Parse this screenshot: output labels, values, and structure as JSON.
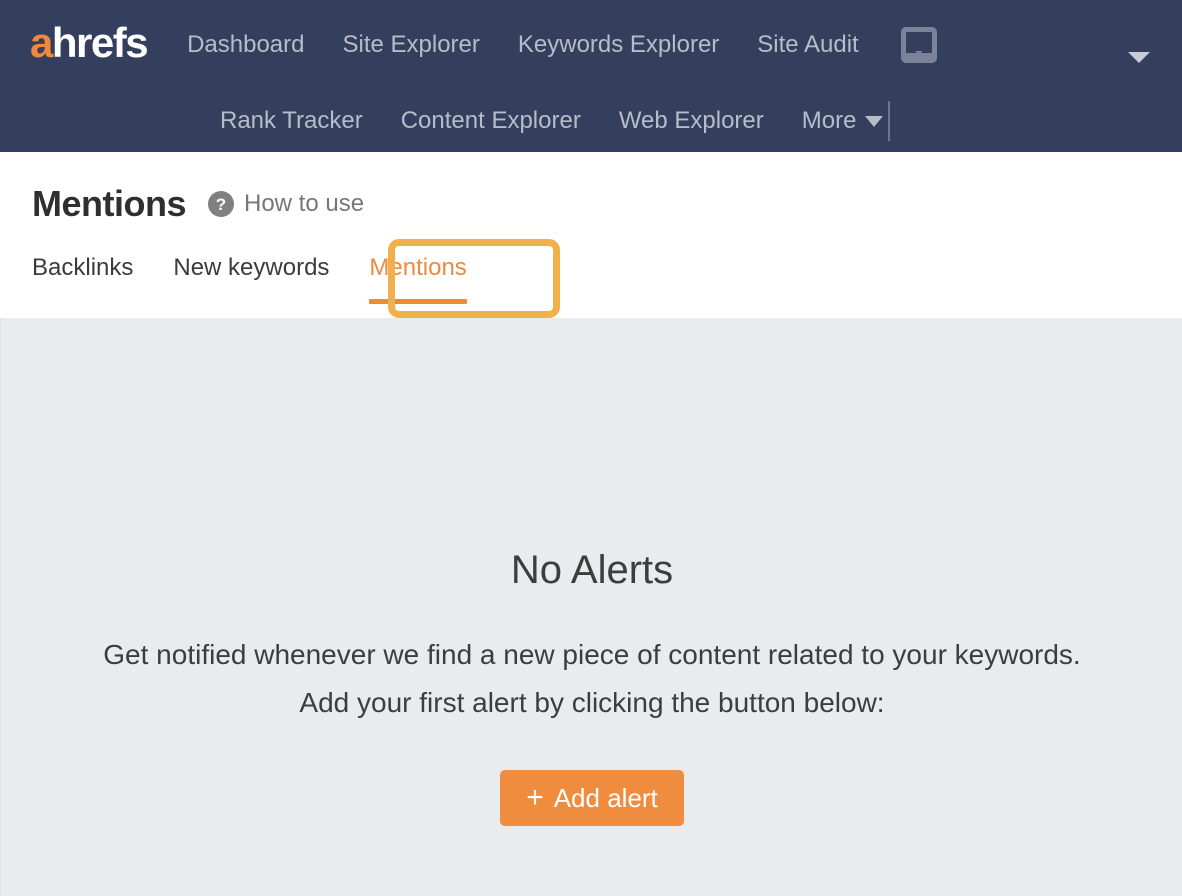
{
  "brand": {
    "logo_a": "a",
    "logo_rest": "hrefs",
    "accent_orange": "#f0893e",
    "nav_background": "#333f5c",
    "content_background": "#eaebed",
    "highlight_amber": "#f0b04c"
  },
  "topnav": {
    "row1": [
      {
        "label": "Dashboard",
        "name": "nav-dashboard"
      },
      {
        "label": "Site Explorer",
        "name": "nav-site-explorer"
      },
      {
        "label": "Keywords Explorer",
        "name": "nav-keywords-explorer"
      },
      {
        "label": "Site Audit",
        "name": "nav-site-audit"
      }
    ],
    "row2": [
      {
        "label": "Rank Tracker",
        "name": "nav-rank-tracker"
      },
      {
        "label": "Content Explorer",
        "name": "nav-content-explorer"
      },
      {
        "label": "Web Explorer",
        "name": "nav-web-explorer"
      }
    ],
    "more_label": "More",
    "inbox_icon": "inbox-icon",
    "account_caret_icon": "chevron-down-icon",
    "more_caret_icon": "chevron-down-icon"
  },
  "header": {
    "title": "Mentions",
    "help_icon": "question-mark-icon",
    "help_glyph": "?",
    "help_label": "How to use"
  },
  "tabs": [
    {
      "label": "Backlinks",
      "name": "tab-backlinks",
      "active": false
    },
    {
      "label": "New keywords",
      "name": "tab-new-keywords",
      "active": false
    },
    {
      "label": "Mentions",
      "name": "tab-mentions",
      "active": true
    }
  ],
  "main": {
    "empty_title": "No Alerts",
    "empty_line_1": "Get notified whenever we find a new piece of content related to your keywords.",
    "empty_line_2": "Add your first alert by clicking the button below:",
    "add_alert_plus": "+",
    "add_alert_label": "Add alert"
  }
}
